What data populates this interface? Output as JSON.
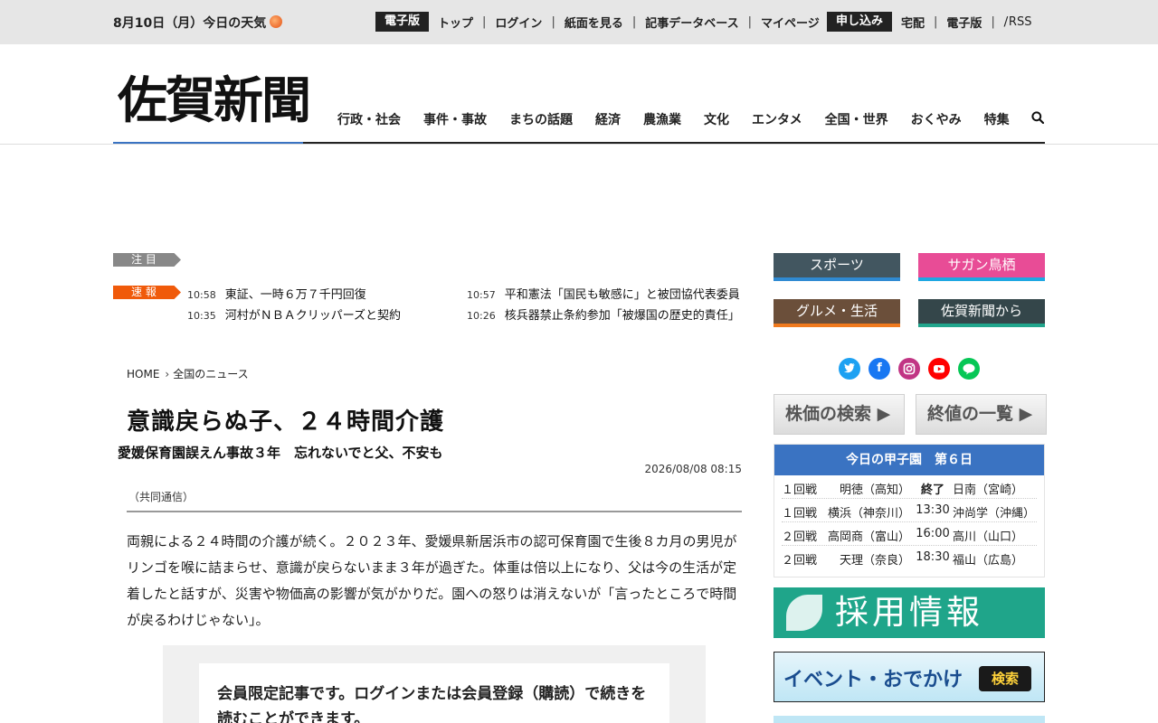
{
  "topbar": {
    "date": "8月10日（月）今日の天気",
    "nav1_label": "電子版",
    "nav1_links": [
      "トップ",
      "ログイン",
      "紙面を見る",
      "記事データベース",
      "マイページ"
    ],
    "nav2_label": "申し込み",
    "nav2_links": [
      "宅配",
      "電子版"
    ],
    "rss": "RSS"
  },
  "header": {
    "logo": "佐賀新聞",
    "nav": [
      "行政・社会",
      "事件・事故",
      "まちの話題",
      "経済",
      "農漁業",
      "文化",
      "エンタメ",
      "全国・世界",
      "おくやみ",
      "特集"
    ]
  },
  "ticker": {
    "attention_label": "注 目",
    "flash_label": "速 報",
    "items": [
      {
        "time": "10:58",
        "text": "東証、一時６万７千円回復"
      },
      {
        "time": "10:35",
        "text": "河村がＮＢＡクリッパーズと契約"
      },
      {
        "time": "10:57",
        "text": "平和憲法「国民も敏感に」と被団協代表委員"
      },
      {
        "time": "10:26",
        "text": "核兵器禁止条約参加「被爆国の歴史的責任」"
      }
    ]
  },
  "breadcrumb": {
    "home": "HOME",
    "current": "全国のニュース"
  },
  "article": {
    "title": "意識戻らぬ子、２４時間介護",
    "subtitle": "愛媛保育園誤えん事故３年　忘れないでと父、不安も",
    "date": "2026/08/08 08:15",
    "source": "（共同通信）",
    "body": "両親による２４時間の介護が続く。２０２３年、愛媛県新居浜市の認可保育園で生後８カ月の男児がリンゴを喉に詰まらせ、意識が戻らないまま３年が過ぎた。体重は倍以上になり、父は今の生活が定着したと話すが、災害や物価高の影響が気がかりだ。園への怒りは消えないが「言ったところで時間が戻るわけじゃない」。",
    "paywall": "会員限定記事です。ログインまたは会員登録（購読）で続きを読むことができます。"
  },
  "sidebar": {
    "buttons": [
      "スポーツ",
      "サガン鳥栖",
      "グルメ・生活",
      "佐賀新聞から"
    ],
    "social_icons": [
      "twitter-icon",
      "facebook-icon",
      "instagram-icon",
      "youtube-icon",
      "line-icon"
    ],
    "stock_search": "株価の検索 ▶",
    "stock_list": "終値の一覧 ▶",
    "koshien": {
      "title": "今日の甲子園　第６日",
      "games": [
        {
          "round": "１回戦",
          "home": "明徳（高知）",
          "status": "終了",
          "away": "日南（宮崎）"
        },
        {
          "round": "１回戦",
          "home": "横浜（神奈川）",
          "status": "13:30",
          "away": "沖尚学（沖縄）"
        },
        {
          "round": "２回戦",
          "home": "高岡商（富山）",
          "status": "16:00",
          "away": "高川（山口）"
        },
        {
          "round": "２回戦",
          "home": "天理（奈良）",
          "status": "18:30",
          "away": "福山（広島）"
        }
      ]
    },
    "recruit": "採用情報",
    "event": {
      "label": "イベント・おでかけ",
      "search": "検索"
    }
  },
  "colors": {
    "accent_blue": "#3a73c2",
    "flash_orange": "#f05a0a",
    "twitter": "#1da1f2",
    "facebook": "#1877f2",
    "instagram": "#c13584",
    "youtube": "#ff0000",
    "line": "#06c755"
  }
}
